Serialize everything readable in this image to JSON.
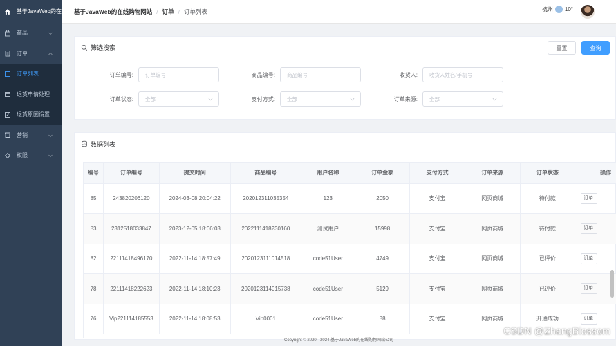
{
  "sidebar": {
    "logo_text": "基于JavaWeb的在",
    "items": [
      {
        "label": "商品",
        "icon": "bag-icon",
        "has_chevron": true
      },
      {
        "label": "订单",
        "icon": "receipt-icon",
        "has_chevron": true,
        "expanded": true
      }
    ],
    "sub_items": [
      {
        "label": "订单列表",
        "icon": "order-list-icon",
        "active": true
      },
      {
        "label": "退货申请处理",
        "icon": "return-box-icon"
      },
      {
        "label": "退货原因设置",
        "icon": "edit-icon"
      }
    ],
    "after_items": [
      {
        "label": "营销",
        "icon": "marketing-icon"
      },
      {
        "label": "权限",
        "icon": "permission-icon"
      }
    ]
  },
  "header": {
    "breadcrumb_root": "基于JavaWeb的在线购物网站",
    "breadcrumb_mid": "订单",
    "breadcrumb_current": "订单列表",
    "sep": "/",
    "city": "杭州",
    "temperature": "10°"
  },
  "filter": {
    "title": "筛选搜索",
    "reset_label": "重置",
    "query_label": "查询",
    "order_no_label": "订单编号:",
    "order_no_placeholder": "订单编号",
    "product_no_label": "商品编号:",
    "product_no_placeholder": "商品编号",
    "receiver_label": "收货人:",
    "receiver_placeholder": "收货人姓名/手机号",
    "status_label": "订单状态:",
    "status_value": "全部",
    "pay_label": "支付方式:",
    "pay_value": "全部",
    "source_label": "订单来源:",
    "source_value": "全部"
  },
  "table": {
    "title": "数据列表",
    "columns": [
      "编号",
      "订单编号",
      "提交时间",
      "商品编号",
      "用户名称",
      "订单金额",
      "支付方式",
      "订单来源",
      "订单状态",
      "操作"
    ],
    "op_label": "订单",
    "rows": [
      [
        "85",
        "243820206120",
        "2024-03-08 20:04:22",
        "2020123110353​54",
        "123",
        "2050",
        "支付宝",
        "网页商城",
        "待付款"
      ],
      [
        "83",
        "2312518033847",
        "2023-12-05 18:06:03",
        "2022111418230160",
        "测试用户",
        "15998",
        "支付宝",
        "网页商城",
        "待付款"
      ],
      [
        "82",
        "22111418496170",
        "2022-11-14 18:57:49",
        "2020123111014518",
        "code51User",
        "4749",
        "支付宝",
        "网页商城",
        "已评价"
      ],
      [
        "78",
        "22111418222623",
        "2022-11-14 18:10:23",
        "2020123114015738",
        "code51User",
        "5129",
        "支付宝",
        "网页商城",
        "已评价"
      ],
      [
        "76",
        "Vip221114185553",
        "2022-11-14 18:08:53",
        "Vip0001",
        "code51User",
        "88",
        "支付宝",
        "网页商城",
        "开通成功"
      ]
    ]
  },
  "footer": "Copyright © 2020 - 2024   基于JavaWeb的在线购物网站公司",
  "watermark": "CSDN @ZhangBlossom",
  "colors": {
    "sidebar": "#304156",
    "accent": "#409eff"
  }
}
